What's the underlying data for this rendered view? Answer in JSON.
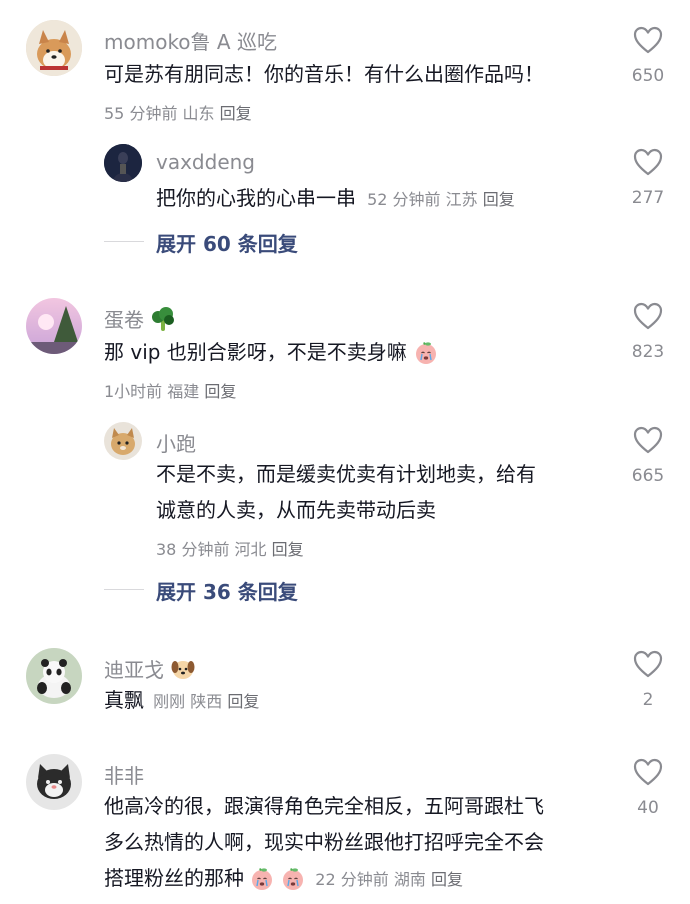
{
  "icons": {
    "like": "heart-outline-icon",
    "broccoli": "broccoli-emoji",
    "dog": "dog-face-emoji",
    "peach": "crying-peach-emoji"
  },
  "colors": {
    "text": "#161823",
    "secondary": "#8a8b91",
    "expand": "#3a4b7a"
  },
  "comments": [
    {
      "username": "momoko鲁 A 巡吃",
      "text": "可是苏有朋同志！你的音乐！有什么出圈作品吗！",
      "time": "55 分钟前",
      "location": "山东",
      "reply_label": "回复",
      "likes": "650",
      "replies": [
        {
          "username": "vaxddeng",
          "text": "把你的心我的心串一串",
          "time": "52 分钟前",
          "location": "江苏",
          "reply_label": "回复",
          "likes": "277"
        }
      ],
      "expand_label": "展开 60 条回复"
    },
    {
      "username": "蛋卷",
      "text": "那 vip 也别合影呀，不是不卖身嘛",
      "time": "1小时前",
      "location": "福建",
      "reply_label": "回复",
      "likes": "823",
      "replies": [
        {
          "username": "小跑",
          "text_line1": "不是不卖，而是缓卖优卖有计划地卖，给有",
          "text_line2": "诚意的人卖，从而先卖带动后卖",
          "time": "38 分钟前",
          "location": "河北",
          "reply_label": "回复",
          "likes": "665"
        }
      ],
      "expand_label": "展开 36 条回复"
    },
    {
      "username": "迪亚戈",
      "text": "真飘",
      "time": "刚刚",
      "location": "陕西",
      "reply_label": "回复",
      "likes": "2"
    },
    {
      "username": "非非",
      "text_line1": "他高冷的很，跟演得角色完全相反，五阿哥跟杜飞",
      "text_line2": "多么热情的人啊，现实中粉丝跟他打招呼完全不会",
      "text_line3": "搭理粉丝的那种",
      "time": "22 分钟前",
      "location": "湖南",
      "reply_label": "回复",
      "likes": "40"
    }
  ]
}
